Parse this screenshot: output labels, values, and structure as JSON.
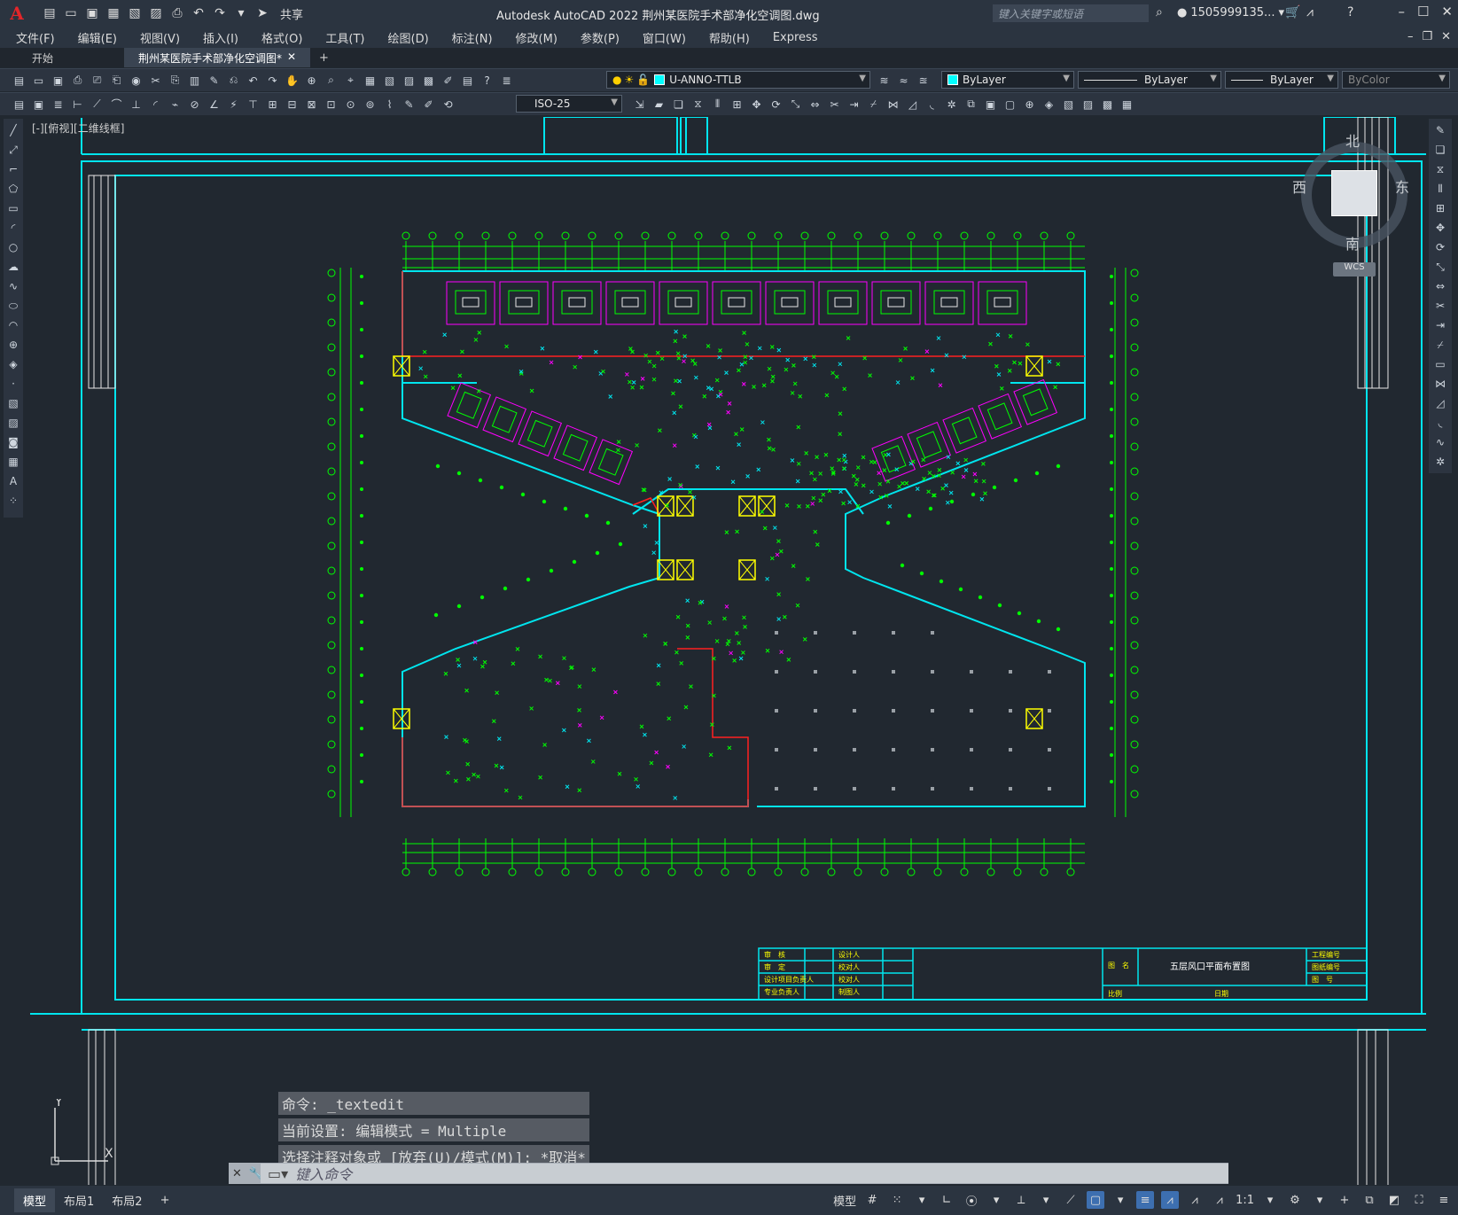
{
  "titlebar": {
    "app_title": "Autodesk AutoCAD 2022    荆州某医院手术部净化空调图.dwg",
    "share": "共享",
    "search_placeholder": "键入关键字或短语",
    "user": "1505999135...",
    "logo": "A"
  },
  "menu": [
    "文件(F)",
    "编辑(E)",
    "视图(V)",
    "插入(I)",
    "格式(O)",
    "工具(T)",
    "绘图(D)",
    "标注(N)",
    "修改(M)",
    "参数(P)",
    "窗口(W)",
    "帮助(H)",
    "Express"
  ],
  "tabs": {
    "start": "开始",
    "active": "荆州某医院手术部净化空调图*",
    "close": "✕",
    "add": "+"
  },
  "toolbar": {
    "layer": "U-ANNO-TTLB",
    "color": "ByLayer",
    "linetype": "ByLayer",
    "lineweight": "ByLayer",
    "plotstyle": "ByColor",
    "dimstyle": "ISO-25"
  },
  "viewport": {
    "label": "[-][俯视][二维线框]"
  },
  "viewcube": {
    "north": "北",
    "south": "南",
    "east": "东",
    "west": "西",
    "wcs": "WCS"
  },
  "ucs": {
    "x": "X",
    "y": "Y"
  },
  "titleblock": {
    "drawing_title": "五层风口平面布置图",
    "fields": [
      "审　核",
      "审　定",
      "设计项目负责人",
      "专业负责人",
      "设计人",
      "校对人",
      "校对人",
      "制图人"
    ],
    "right": [
      "工程编号",
      "图纸编号",
      "图　号"
    ],
    "bottom": [
      "比例",
      "日期"
    ],
    "name_label": "图　名"
  },
  "command": {
    "history": [
      "命令: _textedit",
      "当前设置: 编辑模式 = Multiple",
      "选择注释对象或 [放弃(U)/模式(M)]: *取消*"
    ],
    "placeholder": "键入命令"
  },
  "statusbar": {
    "tabs": [
      "模型",
      "布局1",
      "布局2",
      "+"
    ],
    "model": "模型",
    "scale": "1:1"
  },
  "colors": {
    "background": "#212830",
    "cyan": "#00e5ee",
    "green": "#00ff00",
    "magenta": "#ff00ff",
    "red": "#ff2020",
    "yellow": "#ffff00"
  }
}
